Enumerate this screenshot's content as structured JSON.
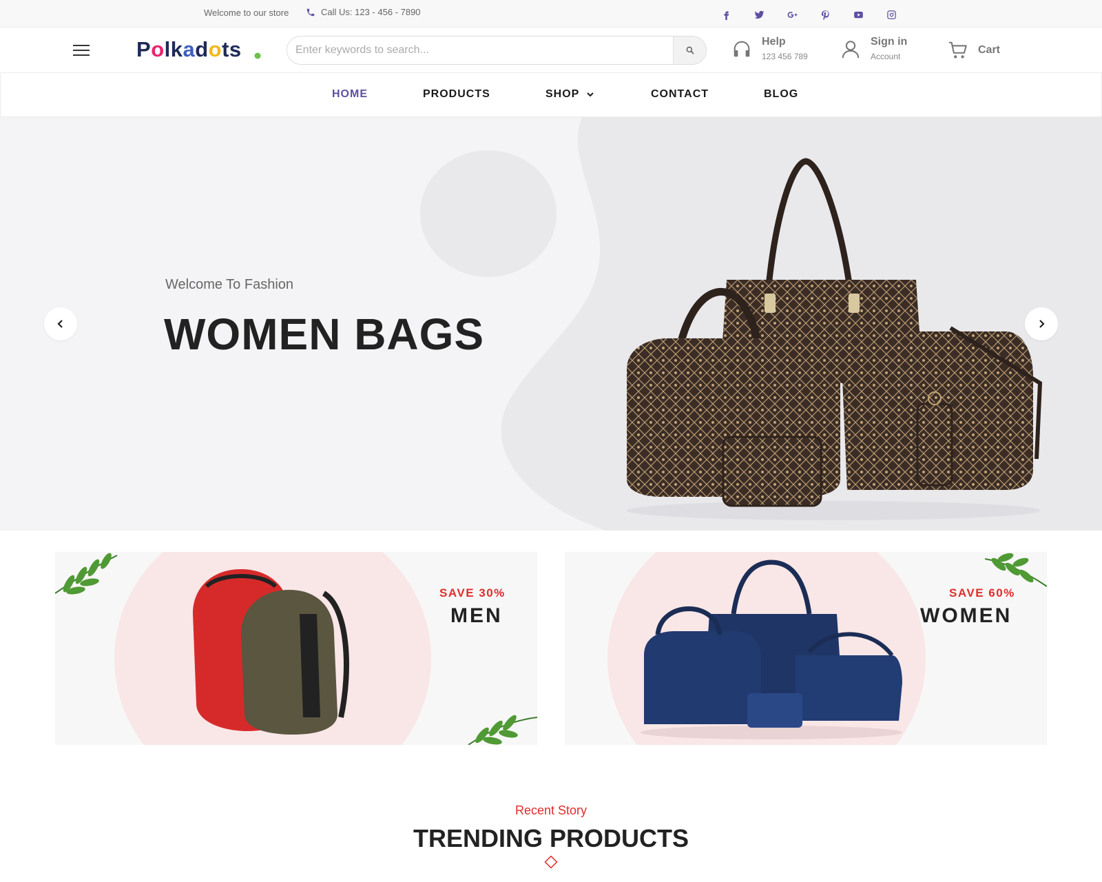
{
  "topbar": {
    "welcome": "Welcome to our store",
    "call": "Call Us: 123 - 456 - 7890",
    "socials": [
      "facebook-icon",
      "twitter-icon",
      "google-plus-icon",
      "pinterest-icon",
      "youtube-icon",
      "instagram-icon"
    ]
  },
  "header": {
    "logo": "Polkadots",
    "search_placeholder": "Enter keywords to search...",
    "help": {
      "label": "Help",
      "value": "123 456 789"
    },
    "signin": {
      "label": "Sign in",
      "value": "Account"
    },
    "cart": {
      "label": "Cart"
    }
  },
  "nav": {
    "items": [
      {
        "label": "HOME",
        "active": true
      },
      {
        "label": "PRODUCTS"
      },
      {
        "label": "SHOP",
        "has_dropdown": true
      },
      {
        "label": "CONTACT"
      },
      {
        "label": "BLOG"
      }
    ]
  },
  "hero": {
    "subtitle": "Welcome To Fashion",
    "title": "WOMEN BAGS"
  },
  "promos": [
    {
      "save": "SAVE 30%",
      "category": "MEN"
    },
    {
      "save": "SAVE 60%",
      "category": "WOMEN"
    }
  ],
  "section": {
    "subtitle": "Recent Story",
    "title": "TRENDING PRODUCTS"
  },
  "colors": {
    "accent": "#5e4fa2",
    "sale_red": "#e02c2c",
    "hero_bg": "#f4f4f6",
    "promo_arc": "#f9e6e7"
  }
}
